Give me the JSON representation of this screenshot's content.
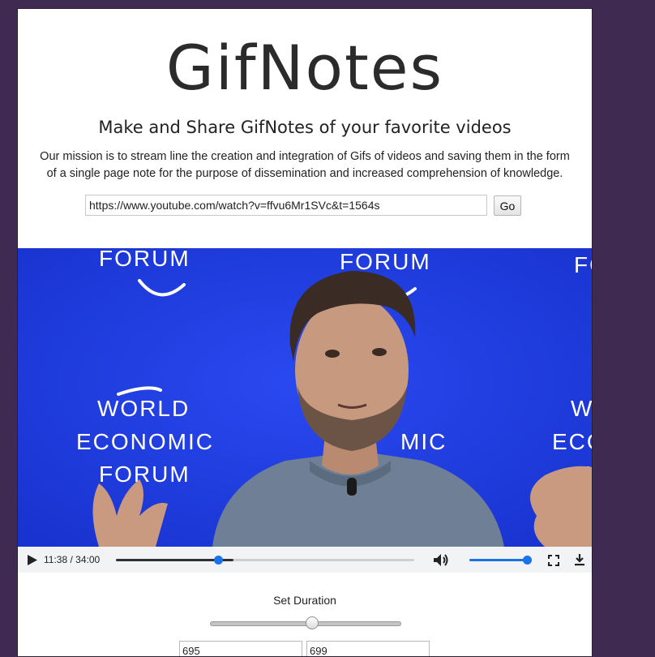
{
  "header": {
    "logo": "GifNotes",
    "tagline": "Make and Share GifNotes of your favorite videos",
    "mission": "Our mission is to stream line the creation and integration of Gifs of videos and saving them in the form of a single page note for the purpose of dissemination and increased comprehension of knowledge."
  },
  "url_form": {
    "value": "https://www.youtube.com/watch?v=ffvu6Mr1SVc&t=1564s",
    "go_label": "Go"
  },
  "video": {
    "backdrop_text": "WORLD ECONOMIC FORUM",
    "backdrop_logo_word": "FORUM",
    "backdrop_color": "#1f3ee0"
  },
  "player": {
    "time": "11:38 / 34:00",
    "progress_fraction": 0.342,
    "buffered_fraction": 0.395,
    "volume_fraction": 1.0,
    "accent_color": "#1a73e8",
    "icons": [
      "play-icon",
      "volume-icon",
      "fullscreen-icon",
      "download-icon"
    ]
  },
  "duration": {
    "label": "Set Duration",
    "slider_fraction": 0.53,
    "start_value": "695",
    "end_value": "699"
  },
  "colors": {
    "page_background": "#3f2b52",
    "card_background": "#ffffff"
  }
}
